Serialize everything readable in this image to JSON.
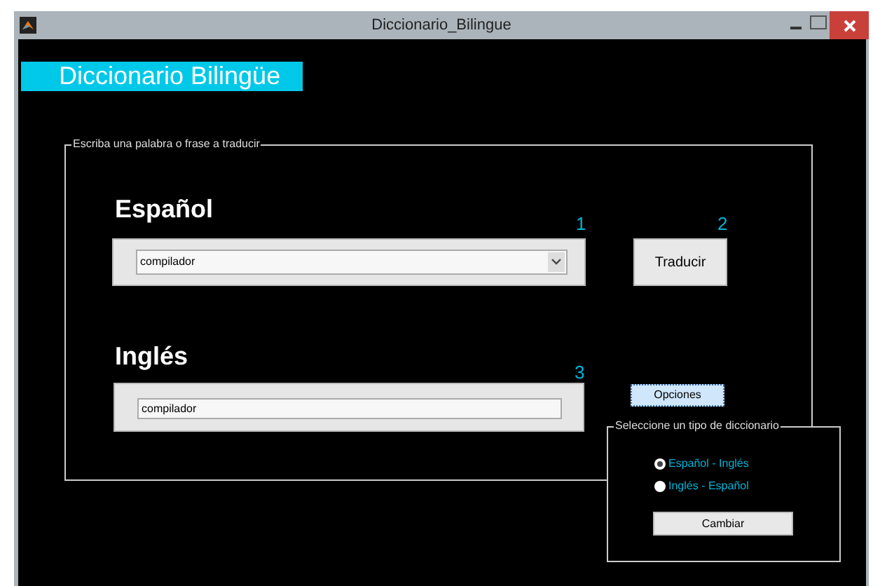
{
  "window": {
    "title": "Diccionario_Bilingue"
  },
  "header": {
    "title": "Diccionario Bilingüe"
  },
  "main_panel": {
    "title": "Escriba una palabra o frase a traducir",
    "source": {
      "label": "Español",
      "marker": "1",
      "value": "compilador"
    },
    "translate": {
      "label": "Traducir",
      "marker": "2"
    },
    "target": {
      "label": "Inglés",
      "marker": "3",
      "value": "compilador"
    }
  },
  "options_button": {
    "label": "Opciones",
    "focused": true
  },
  "dictionary_panel": {
    "title": "Seleccione un tipo de diccionario",
    "options": [
      {
        "label": "Español - Inglés",
        "selected": true
      },
      {
        "label": "Inglés - Español",
        "selected": false
      }
    ],
    "button": "Cambiar"
  }
}
